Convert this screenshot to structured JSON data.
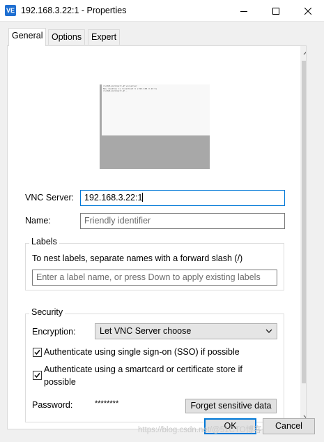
{
  "window": {
    "title": "192.168.3.22:1 - Properties",
    "app_icon_text": "VE"
  },
  "tabs": [
    {
      "label": "General",
      "active": true
    },
    {
      "label": "Options",
      "active": false
    },
    {
      "label": "Expert",
      "active": false
    }
  ],
  "preview": {
    "lines": [
      "root@localhost:~# vncserver",
      "New desktop is localhost:1 (192.168.3.22:1)",
      "root@localhost:~# _"
    ]
  },
  "vnc_server": {
    "label": "VNC Server:",
    "value": "192.168.3.22:1"
  },
  "name": {
    "label": "Name:",
    "placeholder": "Friendly identifier"
  },
  "labels_group": {
    "title": "Labels",
    "hint": "To nest labels, separate names with a forward slash (/)",
    "placeholder": "Enter a label name, or press Down to apply existing labels"
  },
  "security_group": {
    "title": "Security",
    "encryption_label": "Encryption:",
    "encryption_value": "Let VNC Server choose",
    "sso_label": "Authenticate using single sign-on (SSO) if possible",
    "sso_checked": true,
    "smartcard_label_line1": "Authenticate using a smartcard or certificate store if",
    "smartcard_label_line2": "possible",
    "smartcard_checked": true,
    "password_label": "Password:",
    "password_value": "********",
    "forget_button": "Forget sensitive data"
  },
  "buttons": {
    "ok": "OK",
    "cancel": "Cancel"
  },
  "watermark": "https://blog.csdn.net/@51CTO博客",
  "colors": {
    "accent": "#0078d7",
    "title_bg": "#ffffff",
    "dialog_bg": "#f0f0f0"
  }
}
